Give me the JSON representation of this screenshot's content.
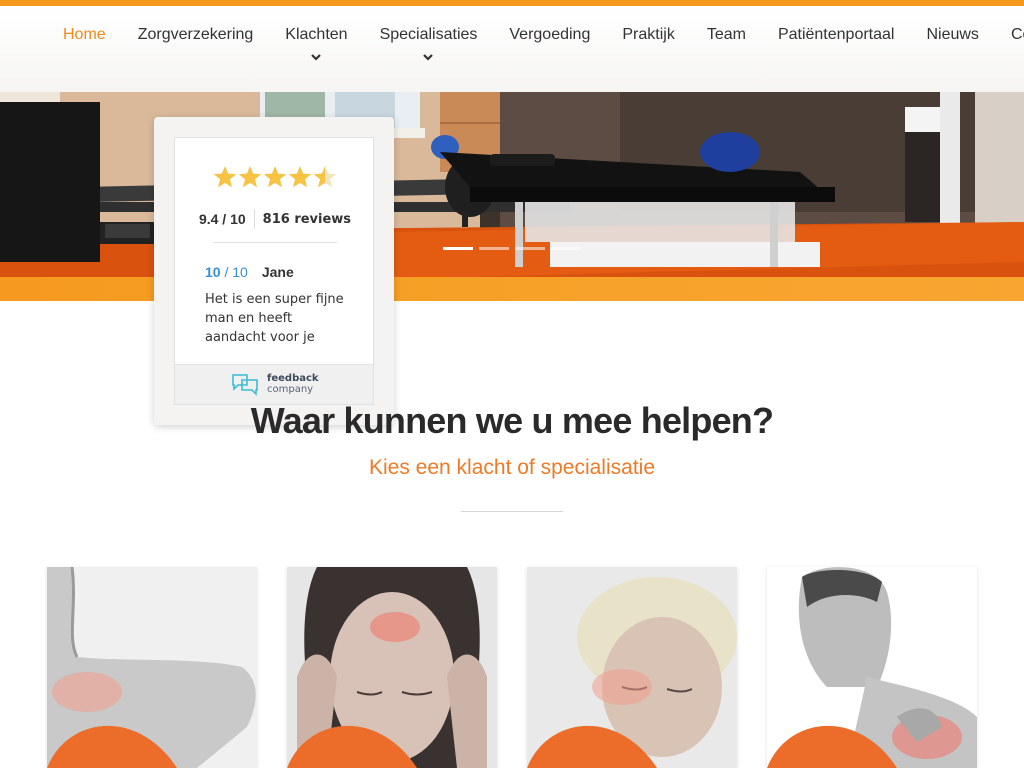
{
  "nav": {
    "items": [
      {
        "label": "Home",
        "active": true,
        "dropdown": false
      },
      {
        "label": "Zorgverzekering",
        "active": false,
        "dropdown": false
      },
      {
        "label": "Klachten",
        "active": false,
        "dropdown": true
      },
      {
        "label": "Specialisaties",
        "active": false,
        "dropdown": true
      },
      {
        "label": "Vergoeding",
        "active": false,
        "dropdown": false
      },
      {
        "label": "Praktijk",
        "active": false,
        "dropdown": false
      },
      {
        "label": "Team",
        "active": false,
        "dropdown": false
      },
      {
        "label": "Patiëntenportaal",
        "active": false,
        "dropdown": false
      },
      {
        "label": "Nieuws",
        "active": false,
        "dropdown": false
      },
      {
        "label": "Contact",
        "active": false,
        "dropdown": false
      }
    ]
  },
  "hero": {
    "slides": 4,
    "active_slide": 1
  },
  "review_widget": {
    "stars": 4.5,
    "score": "9.4",
    "score_max": "/ 10",
    "review_count": "816 reviews",
    "review": {
      "score": "10",
      "score_max": "/ 10",
      "author": "Jane",
      "text": "Het is een super fijne man en heeft aandacht voor je"
    },
    "provider_line1": "feedback",
    "provider_line2": "company"
  },
  "section": {
    "title": "Waar kunnen we u mee helpen?",
    "subtitle": "Kies een klacht of specialisatie"
  },
  "cards": [
    {
      "icon": "elbow-photo"
    },
    {
      "icon": "headache-photo"
    },
    {
      "icon": "neck-pain-photo"
    },
    {
      "icon": "shoulder-pain-photo"
    }
  ],
  "colors": {
    "accent": "#f39a1e",
    "nav_active": "#ef8a1c",
    "subtitle": "#ee7a27",
    "review_blue": "#3a8edb",
    "star": "#f6c343"
  }
}
